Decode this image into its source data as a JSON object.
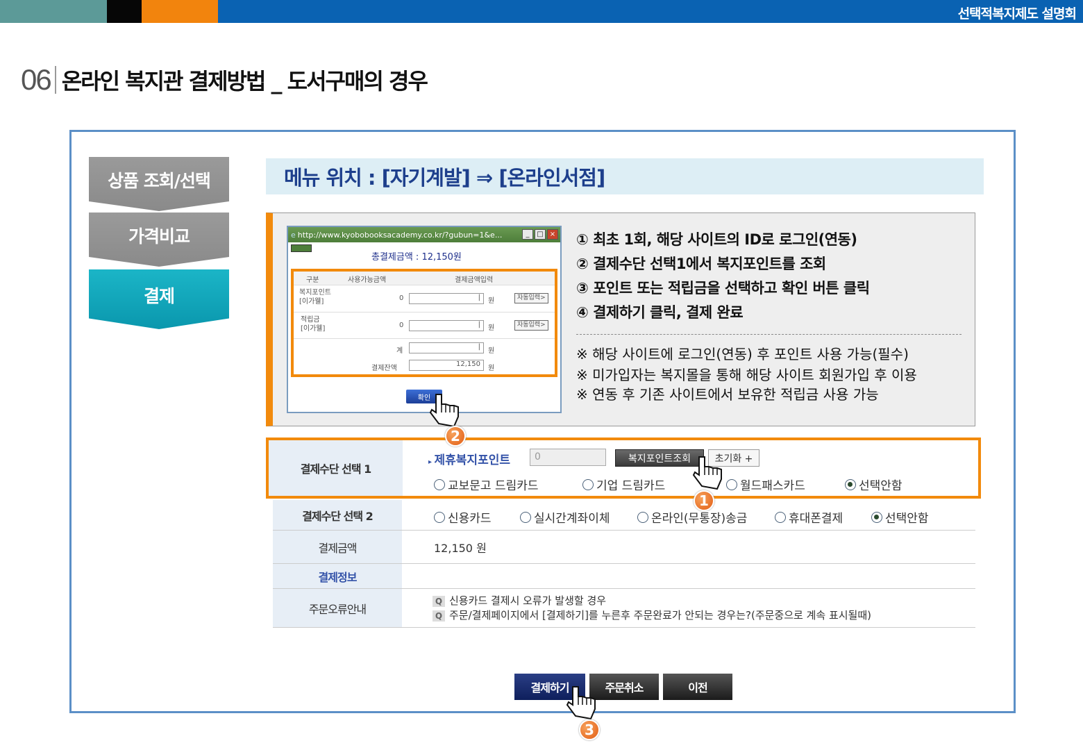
{
  "header": {
    "title": "선택적복지제도 설명회",
    "section_number": "06",
    "section_title": "온라인 복지관 결제방법 _ 도서구매의 경우"
  },
  "steps": [
    {
      "label": "상품 조회/선택",
      "active": false
    },
    {
      "label": "가격비교",
      "active": false
    },
    {
      "label": "결제",
      "active": true
    }
  ],
  "menu_location": "메뉴 위치 : [자기계발] ⇒ [온라인서점]",
  "popup": {
    "url": "http://www.kyobobooksacademy.co.kr/?gubun=1&e...",
    "total_label": "총결제금액 : 12,150원",
    "columns": [
      "구분",
      "사용가능금액",
      "결제금액입력"
    ],
    "rows": [
      {
        "name": "복지포인트\n[이가웰]",
        "available": "0",
        "unit": "원",
        "button": "자동입력>"
      },
      {
        "name": "적립금\n[이가웰]",
        "available": "0",
        "unit": "원",
        "button": "자동입력>"
      }
    ],
    "sum_label": "계",
    "sum_unit": "원",
    "balance_label": "결제잔액",
    "balance_value": "12,150",
    "balance_unit": "원",
    "confirm_button": "확인"
  },
  "instructions": [
    "① 최초 1회, 해당 사이트의 ID로 로그인(연동)",
    "② 결제수단 선택1에서 복지포인트를 조회",
    "③ 포인트 또는 적립금을 선택하고 확인 버튼 클릭",
    "④ 결제하기 클릭, 결제 완료"
  ],
  "notes": [
    "※ 해당 사이트에 로그인(연동) 후 포인트 사용 가능(필수)",
    "※ 미가입자는 복지몰을 통해 해당 사이트 회원가입 후 이용",
    "※ 연동 후 기존 사이트에서 보유한 적립금 사용 가능"
  ],
  "payment1": {
    "label": "결제수단 선택 1",
    "points_label": "제휴복지포인트",
    "points_value": "0",
    "lookup_button": "복지포인트조회",
    "reset_button": "초기화 +",
    "options": [
      "교보문고 드림카드",
      "기업 드림카드",
      "월드패스카드",
      "선택안함"
    ],
    "selected": "선택안함"
  },
  "payment2": {
    "label": "결제수단 선택 2",
    "options": [
      "신용카드",
      "실시간계좌이체",
      "온라인(무통장)송금",
      "휴대폰결제",
      "선택안함"
    ],
    "selected": "선택안함"
  },
  "amount": {
    "label": "결제금액",
    "value": "12,150 원"
  },
  "payinfo": {
    "label": "결제정보"
  },
  "order_error": {
    "label": "주문오류안내",
    "items": [
      "신용카드 결제시 오류가 발생할 경우",
      "주문/결제페이지에서 [결제하기]를 누른후 주문완료가 안되는 경우는?(주문중으로 계속 표시될때)"
    ]
  },
  "buttons": {
    "pay": "결제하기",
    "cancel": "주문취소",
    "prev": "이전"
  },
  "badges": [
    "1",
    "2",
    "3"
  ],
  "colors": {
    "accent_orange": "#f28a0c",
    "topbar_blue": "#0a62b2",
    "active_step": "#0aa2b7"
  }
}
